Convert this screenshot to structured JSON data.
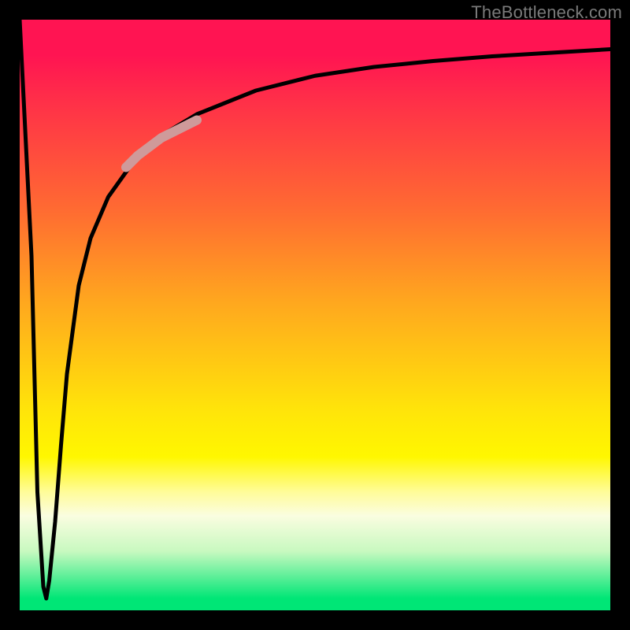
{
  "watermark": "TheBottleneck.com",
  "colors": {
    "frame": "#000000",
    "curve": "#000000",
    "highlight": "#cf9a9a",
    "grad_top": "#ff1452",
    "grad_mid": "#ffe40a",
    "grad_bottom": "#00e676"
  },
  "chart_data": {
    "type": "line",
    "title": "",
    "xlabel": "",
    "ylabel": "",
    "xlim": [
      0,
      100
    ],
    "ylim": [
      0,
      100
    ],
    "grid": false,
    "legend": false,
    "series": [
      {
        "name": "bottleneck-curve",
        "color": "#000000",
        "x": [
          0,
          2,
          3,
          4,
          4.5,
          5,
          6,
          7,
          8,
          10,
          12,
          15,
          20,
          25,
          30,
          35,
          40,
          50,
          60,
          70,
          80,
          90,
          100
        ],
        "y": [
          100,
          60,
          20,
          4,
          2,
          5,
          15,
          28,
          40,
          55,
          63,
          70,
          77,
          81,
          84,
          86,
          88,
          90.5,
          92,
          93,
          93.8,
          94.4,
          95
        ]
      },
      {
        "name": "highlight-segment",
        "color": "#cf9a9a",
        "x": [
          18,
          20,
          22,
          24,
          26,
          28,
          30
        ],
        "y": [
          75,
          77,
          78.5,
          80,
          81,
          82,
          83
        ]
      }
    ],
    "annotations": []
  }
}
